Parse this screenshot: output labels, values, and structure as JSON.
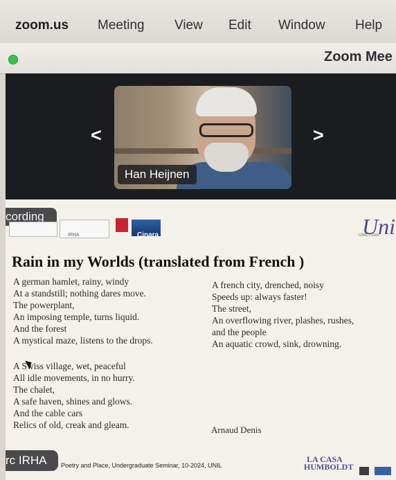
{
  "menubar": {
    "items": [
      "zoom.us",
      "Meeting",
      "View",
      "Edit",
      "Window",
      "Help"
    ]
  },
  "window": {
    "title": "Zoom Mee"
  },
  "video": {
    "participant_name": "Han Heijnen",
    "previous_label": "<",
    "next_label": ">"
  },
  "recording": {
    "label": "cording"
  },
  "logos": {
    "irha": "IRHA",
    "cinara": "Cinara",
    "uni": "Uni",
    "uni_sub": "UNIL | univ"
  },
  "slide": {
    "title": "Rain in my Worlds (translated from French )",
    "left_stanza_1": [
      "A german hamlet, rainy, windy",
      "At a standstill; nothing dares move.",
      "The powerplant,",
      "An imposing temple, turns liquid.",
      "And the forest",
      "A mystical maze, listens to the drops."
    ],
    "left_stanza_2": [
      "A Swiss village, wet, peaceful",
      "All idle movements, in no hurry.",
      "The chalet,",
      "A safe haven, shines and glows.",
      "And the cable cars",
      "Relics of old, creak and gleam."
    ],
    "right_stanza": [
      "A french city, drenched, noisy",
      "Speeds up: always faster!",
      "The street,",
      "An overflowing river, plashes, rushes,",
      "and the people",
      "An aquatic crowd, sink, drowning."
    ],
    "author": "Arnaud Denis",
    "footer_label": "rc IRHA",
    "footer_note": "Poetry and Place, Undergraduate Seminar, 10-2024, UNIL",
    "humboldt": "LA CASA\nHUMBOLDT"
  },
  "icons": {
    "record": "record-icon",
    "green_light": "green-window-button-icon"
  },
  "colors": {
    "accent_green": "#37c04a",
    "name_tag_bg": "#1f1f21",
    "slide_bg": "#f4f1ea"
  }
}
